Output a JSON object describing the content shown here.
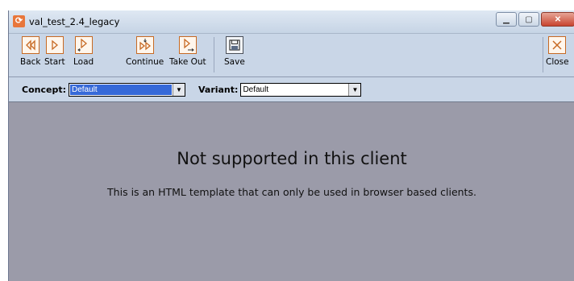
{
  "window": {
    "title": "val_test_2.4_legacy"
  },
  "toolbar": {
    "back": "Back",
    "start": "Start",
    "load": "Load",
    "continue": "Continue",
    "take_out": "Take Out",
    "save": "Save",
    "close": "Close"
  },
  "selectors": {
    "concept_label": "Concept:",
    "concept_value": "Default",
    "variant_label": "Variant:",
    "variant_value": "Default"
  },
  "content": {
    "heading": "Not supported in this client",
    "message": "This is an HTML template that can only be used in browser based clients."
  },
  "colors": {
    "accent": "#c76a24",
    "content_bg": "#9b9ba9",
    "toolbar_bg": "#c9d6e7"
  }
}
